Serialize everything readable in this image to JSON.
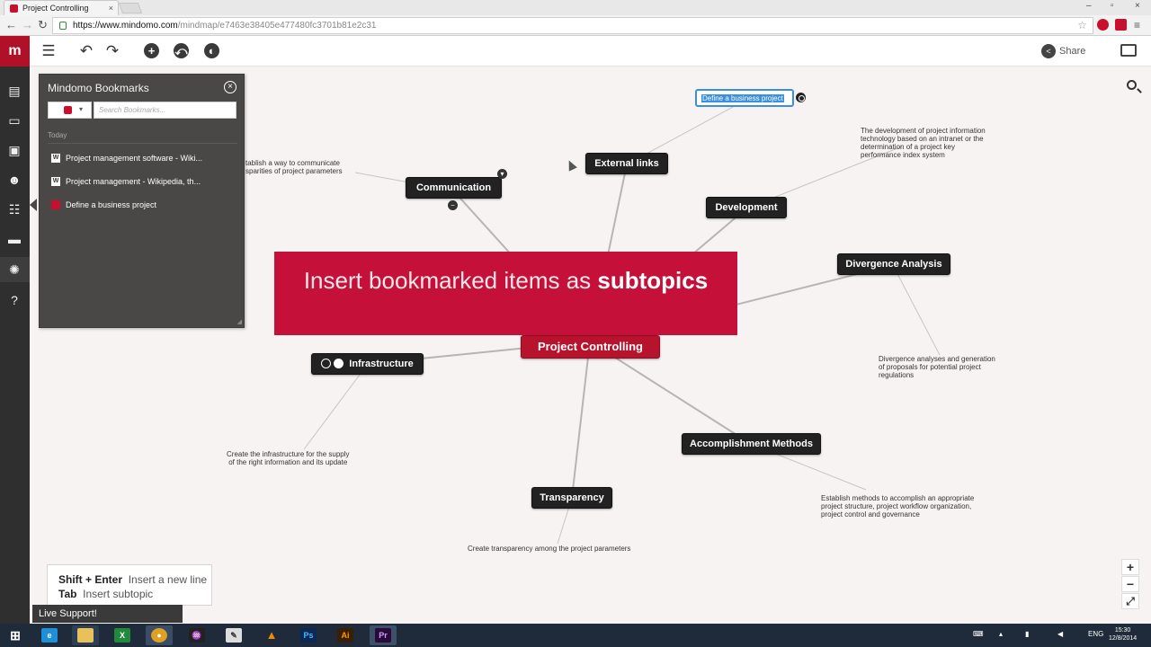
{
  "browser": {
    "tab_title": "Project Controlling",
    "tab_close": "×",
    "url_host": "https://www.mindomo.com",
    "url_path": "/mindmap/e7463e38405e477480fc3701b81e2c31",
    "window_controls": [
      "–",
      "▫",
      "×"
    ]
  },
  "toolbar": {
    "share_label": "Share",
    "icons": [
      "menu-icon",
      "undo-icon",
      "redo-icon",
      "add-topic-icon",
      "relationship-icon",
      "theme-icon"
    ]
  },
  "sidebar": {
    "items": [
      "outline",
      "slides",
      "image",
      "emoticon",
      "tasks",
      "comments",
      "bookmarks",
      "help"
    ]
  },
  "bookmarks": {
    "title": "Mindomo Bookmarks",
    "search_placeholder": "Search Bookmarks...",
    "group_label": "Today",
    "items": [
      {
        "label": "Project management software - Wiki...",
        "icon": "W"
      },
      {
        "label": "Project management - Wikipedia, th...",
        "icon": "W"
      },
      {
        "label": "Define a business project",
        "icon": "mindomo"
      }
    ]
  },
  "mindmap": {
    "central": "Project Controlling",
    "topics": {
      "communication": "Communication",
      "external_links": "External links",
      "development": "Development",
      "divergence": "Divergence Analysis",
      "infrastructure": "Infrastructure",
      "accomplishment": "Accomplishment Methods",
      "transparency": "Transparency"
    },
    "selected_topic": "Define a business project",
    "notes": {
      "communication": [
        "tablish a way to communicate",
        "sparities of project parameters"
      ],
      "development": [
        "The development of project information",
        "technology based on an intranet or the",
        "determination of a project key",
        "performance index system"
      ],
      "divergence": [
        "Divergence analyses and generation",
        "of proposals for potential project",
        "regulations"
      ],
      "infrastructure": [
        "Create the infrastructure for the supply",
        "of the right information and its update"
      ],
      "accomplishment": [
        "Establish methods to accomplish an appropriate",
        "project structure, project workflow organization,",
        "project control and governance"
      ],
      "transparency": [
        "Create transparency among the project parameters"
      ]
    }
  },
  "banner": {
    "plain": "Insert bookmarked items as ",
    "bold": "subtopics"
  },
  "hint": {
    "key1": "Shift + Enter",
    "desc1": "Insert a new line",
    "key2": "Tab",
    "desc2": "Insert subtopic"
  },
  "live_support": "Live Support!",
  "zoom": {
    "in": "+",
    "out": "−",
    "fit": "⤢"
  },
  "taskbar": {
    "lang": "ENG",
    "time": "15:30",
    "date": "12/8/2014"
  },
  "colors": {
    "brand": "#b01028",
    "banner": "#c5103a",
    "central_node": "#b8132d",
    "node": "#222222",
    "selection": "#3a8fe0"
  }
}
